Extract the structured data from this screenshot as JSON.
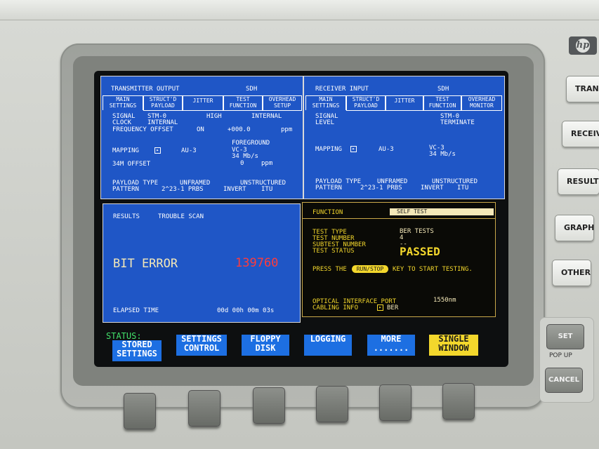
{
  "tx": {
    "title": "TRANSMITTER OUTPUT",
    "mode": "SDH",
    "tabs": [
      "MAIN\nSETTINGS",
      "STRUCT'D\nPAYLOAD",
      "JITTER",
      "TEST\nFUNCTION",
      "OVERHEAD\nSETUP"
    ],
    "signal_label": "SIGNAL",
    "signal_value": "STM-0",
    "signal_level": "HIGH",
    "signal_internal": "INTERNAL",
    "clock_label": "CLOCK",
    "clock_value": "INTERNAL",
    "freq_label": "FREQUENCY OFFSET",
    "freq_state": "ON",
    "freq_value": "+000.0",
    "freq_unit": "ppm",
    "foreground": "FOREGROUND",
    "mapping_label": "MAPPING",
    "mapping_value": "AU-3",
    "vc": "VC-3",
    "rate": "34 Mb/s",
    "offset_label": "34M OFFSET",
    "offset_value": "0",
    "offset_unit": "ppm",
    "payload_label": "PAYLOAD TYPE",
    "payload_value": "UNFRAMED",
    "payload_struct": "UNSTRUCTURED",
    "pattern_label": "PATTERN",
    "pattern_value": "2^23-1 PRBS",
    "pattern_invert": "INVERT",
    "pattern_std": "ITU"
  },
  "rx": {
    "title": "RECEIVER INPUT",
    "mode": "SDH",
    "tabs": [
      "MAIN\nSETTINGS",
      "STRUCT'D\nPAYLOAD",
      "JITTER",
      "TEST\nFUNCTION",
      "OVERHEAD\nMONITOR"
    ],
    "signal_label": "SIGNAL",
    "signal_value": "STM-0",
    "level_label": "LEVEL",
    "level_value": "TERMINATE",
    "mapping_label": "MAPPING",
    "mapping_value": "AU-3",
    "vc": "VC-3",
    "rate": "34 Mb/s",
    "payload_label": "PAYLOAD TYPE",
    "payload_value": "UNFRAMED",
    "payload_struct": "UNSTRUCTURED",
    "pattern_label": "PATTERN",
    "pattern_value": "2^23-1 PRBS",
    "pattern_invert": "INVERT",
    "pattern_std": "ITU"
  },
  "results": {
    "title": "RESULTS",
    "subtitle": "TROUBLE SCAN",
    "error_label": "BIT ERROR",
    "error_count": "139760",
    "elapsed_label": "ELAPSED TIME",
    "elapsed_value": "00d 00h 00m 03s"
  },
  "function": {
    "title": "FUNCTION",
    "selected": "SELF TEST",
    "test_type_label": "TEST TYPE",
    "test_type_value": "BER TESTS",
    "test_number_label": "TEST NUMBER",
    "test_number_value": "4",
    "subtest_label": "SUBTEST NUMBER",
    "subtest_value": "--",
    "status_label": "TEST STATUS",
    "status_value": "PASSED",
    "press_pre": "PRESS THE",
    "press_key": "RUN/STOP",
    "press_post": "KEY TO START TESTING.",
    "port_label": "OPTICAL INTERFACE PORT",
    "port_value": "1550nm",
    "cabling_label": "CABLING INFO",
    "cabling_value": "BER"
  },
  "status": {
    "label": "STATUS:",
    "softkeys": [
      "STORED\nSETTINGS",
      "SETTINGS\nCONTROL",
      "FLOPPY\nDISK",
      "LOGGING",
      "MORE\n.......",
      "SINGLE\nWINDOW"
    ]
  },
  "side_buttons": [
    "TRANSM",
    "RECEIVE",
    "RESULTS",
    "GRAPH",
    "OTHER"
  ],
  "set_label": "SET",
  "popup_label": "POP UP",
  "cancel_label": "CANCEL",
  "brand": "hp",
  "colors": {
    "panel_blue": "#1f56c6",
    "error_red": "#ff3b3b",
    "highlight_yellow": "#f3d72c",
    "softkey_blue": "#1d6fe2"
  }
}
